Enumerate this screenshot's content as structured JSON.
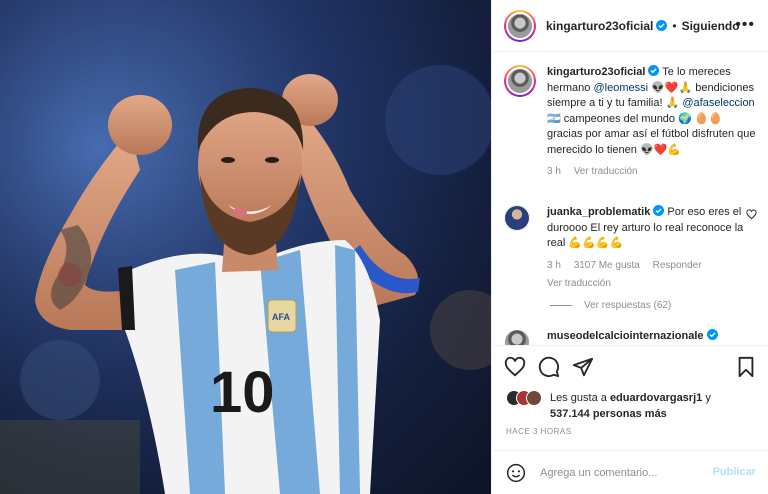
{
  "post": {
    "image_alt": "Lionel Messi celebrando con los puños en alto",
    "jersey_number": "10",
    "jersey_badge": "AFA"
  },
  "header": {
    "username": "kingarturo23oficial",
    "separator": "•",
    "follow_label": "Siguiendo",
    "more_label": "•••"
  },
  "caption": {
    "username": "kingarturo23oficial",
    "text_1": " Te lo mereces hermano ",
    "mention_1": "@leomessi",
    "text_2": " 👽❤️🙏 bendiciones siempre a ti y tu familia! 🙏 ",
    "mention_2": "@afaseleccion",
    "text_3": " 🇦🇷 campeones del mundo 🌍 🥚🥚 gracias por amar así el fútbol disfruten que merecido lo tienen 👽❤️💪",
    "time": "3 h",
    "translate_label": "Ver traducción"
  },
  "comment": {
    "username": "juanka_problematik",
    "text": " Por eso eres el duroooo El rey arturo lo real reconoce la real 💪💪💪💪",
    "time": "3 h",
    "likes": "3107 Me gusta",
    "reply_label": "Responder",
    "translate_label": "Ver traducción",
    "view_replies": "Ver respuestas (62)"
  },
  "next_comment": {
    "username": "museodelcalciointernazionale"
  },
  "likes": {
    "prefix": "Les gusta a ",
    "user": "eduardovargasrj1",
    "middle": " y",
    "count": "537.144 personas más"
  },
  "timestamp": "HACE 3 HORAS",
  "composer": {
    "placeholder": "Agrega un comentario...",
    "publish_label": "Publicar"
  },
  "icons": [
    "heart-icon",
    "comment-icon",
    "share-icon",
    "bookmark-icon",
    "emoji-icon",
    "verified-icon"
  ],
  "colors": {
    "verified": "#0095f6",
    "link": "#00376b",
    "muted": "#8e8e8e",
    "publish_disabled": "#b2dffc",
    "jersey_blue": "#75aadb"
  }
}
